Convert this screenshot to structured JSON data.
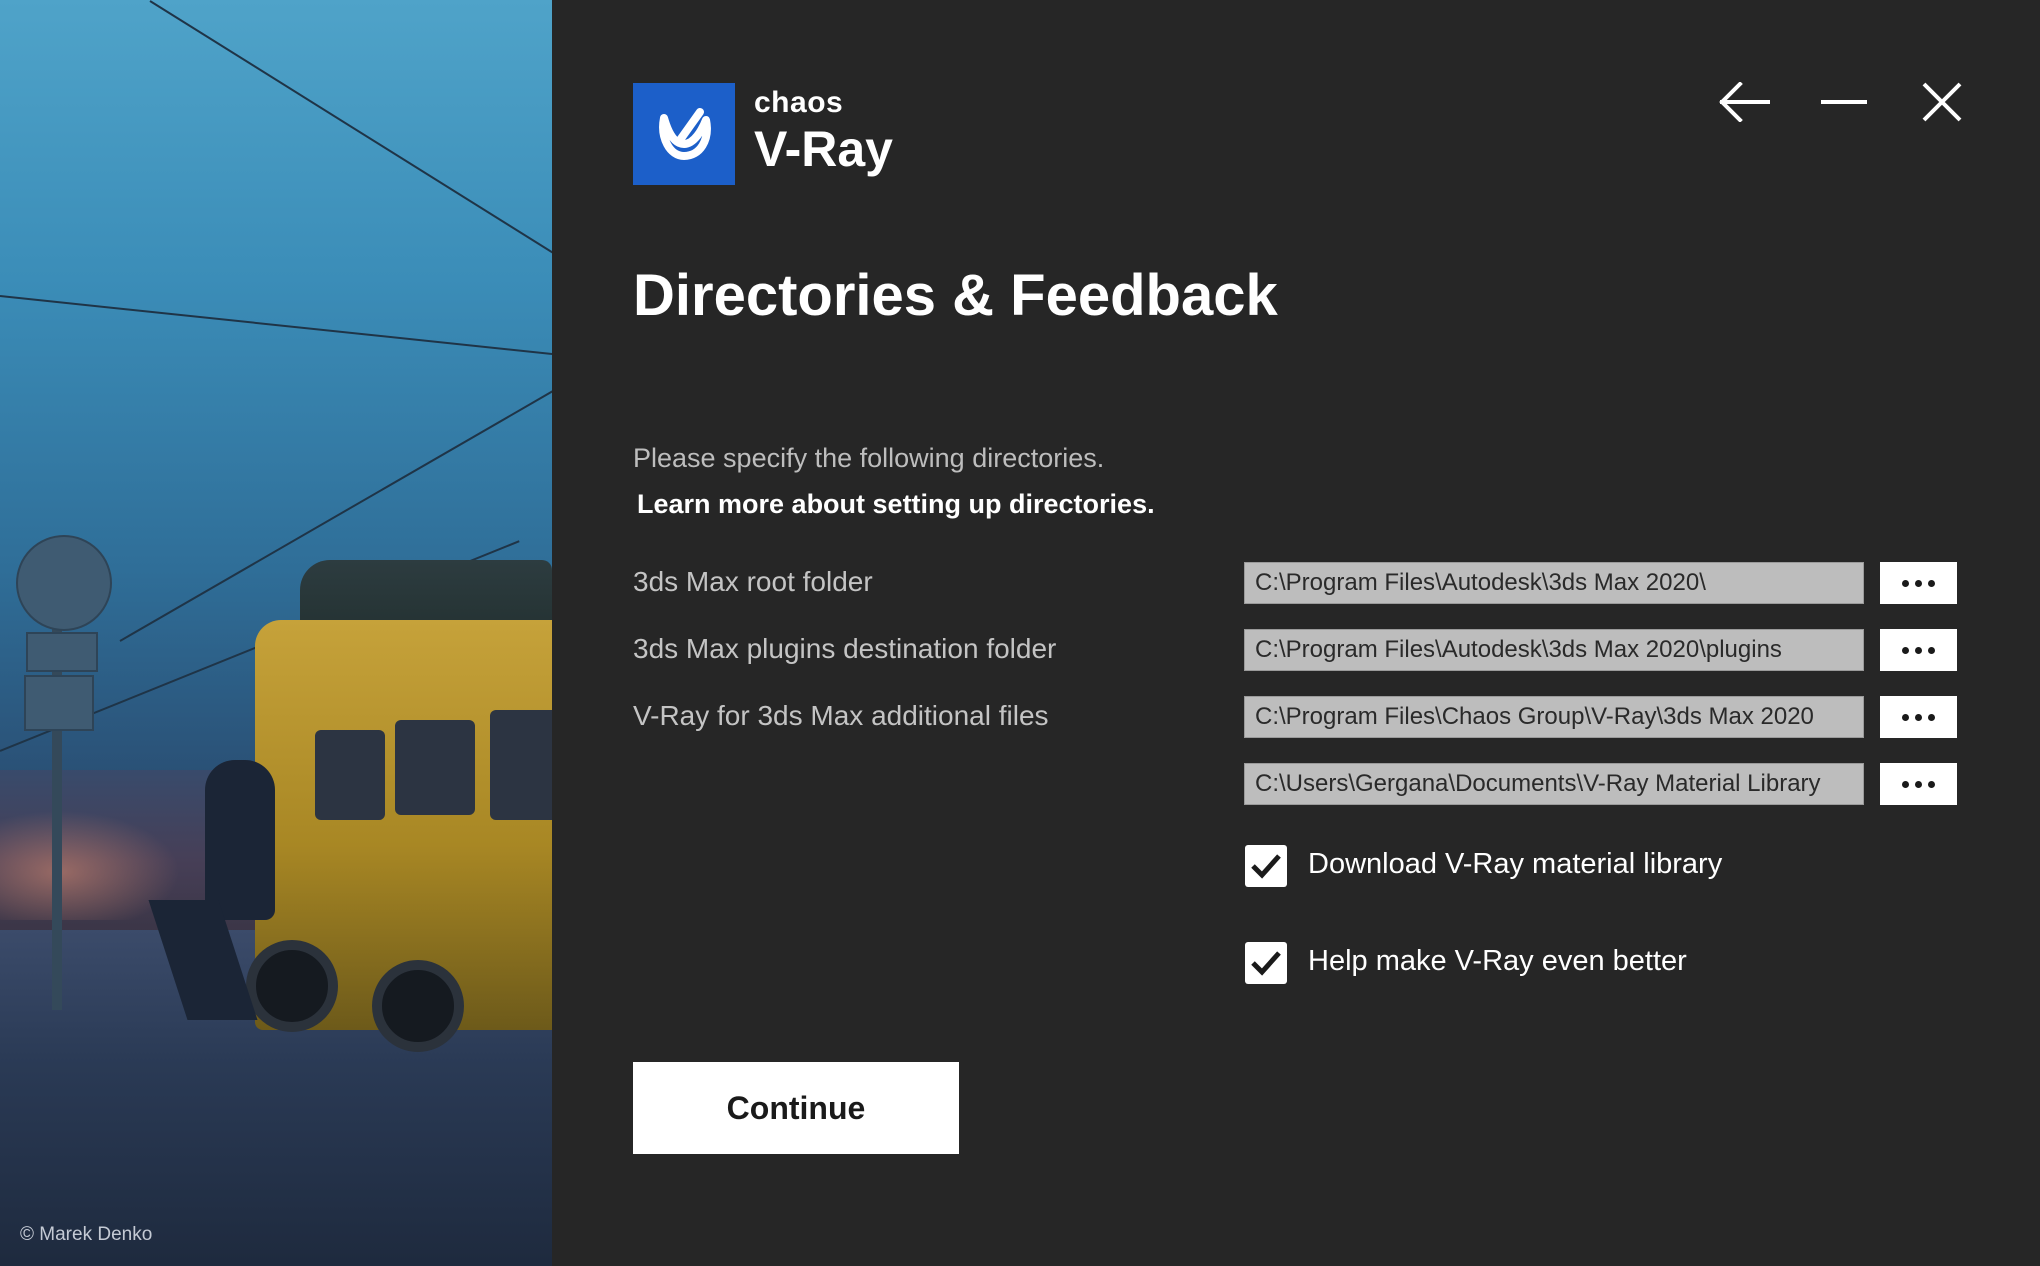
{
  "photo": {
    "credit": "© Marek Denko"
  },
  "brand": {
    "top": "chaos",
    "name": "V-Ray",
    "logo_color": "#1c5fc9",
    "logo_icon": "vray-v-logo-icon"
  },
  "window_controls": {
    "back_icon": "arrow-left-icon",
    "minimize_icon": "minimize-icon",
    "close_icon": "close-icon"
  },
  "page": {
    "title": "Directories & Feedback",
    "intro": "Please specify the following directories.",
    "learn_more": "Learn more about setting up directories."
  },
  "directories": [
    {
      "label": "3ds Max root folder",
      "path": "C:\\Program Files\\Autodesk\\3ds Max 2020\\"
    },
    {
      "label": "3ds Max plugins destination folder",
      "path": "C:\\Program Files\\Autodesk\\3ds Max 2020\\plugins"
    },
    {
      "label": "V-Ray for 3ds Max additional files",
      "path": "C:\\Program Files\\Chaos Group\\V-Ray\\3ds Max 2020"
    },
    {
      "label": "",
      "path": "C:\\Users\\Gergana\\Documents\\V-Ray Material Library"
    }
  ],
  "options": [
    {
      "label": "Download V-Ray material library",
      "checked": true
    },
    {
      "label": "Help make V-Ray even better",
      "checked": true
    }
  ],
  "actions": {
    "continue_label": "Continue"
  }
}
